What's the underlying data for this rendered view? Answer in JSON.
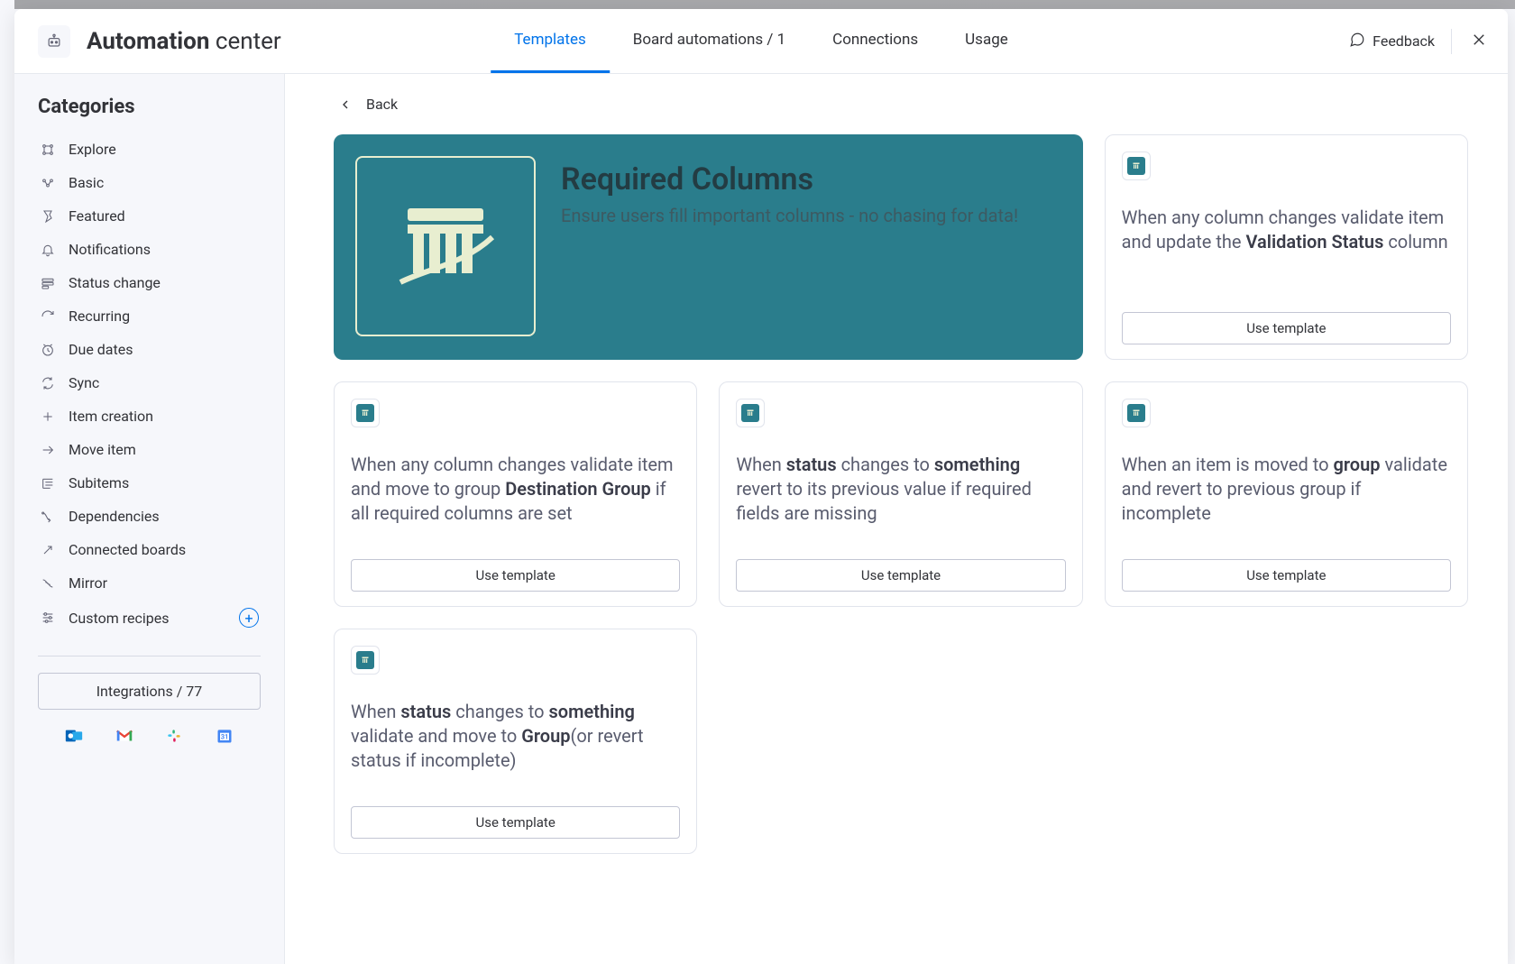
{
  "header": {
    "title_bold": "Automation",
    "title_light": " center",
    "tabs": [
      {
        "label": "Templates",
        "active": true
      },
      {
        "label": "Board automations / 1",
        "active": false
      },
      {
        "label": "Connections",
        "active": false
      },
      {
        "label": "Usage",
        "active": false
      }
    ],
    "feedback": "Feedback"
  },
  "sidebar": {
    "title": "Categories",
    "items": [
      {
        "label": "Explore",
        "icon": "explore"
      },
      {
        "label": "Basic",
        "icon": "basic"
      },
      {
        "label": "Featured",
        "icon": "featured"
      },
      {
        "label": "Notifications",
        "icon": "bell"
      },
      {
        "label": "Status change",
        "icon": "status"
      },
      {
        "label": "Recurring",
        "icon": "recurring"
      },
      {
        "label": "Due dates",
        "icon": "clock"
      },
      {
        "label": "Sync",
        "icon": "sync"
      },
      {
        "label": "Item creation",
        "icon": "plus"
      },
      {
        "label": "Move item",
        "icon": "arrow"
      },
      {
        "label": "Subitems",
        "icon": "subitems"
      },
      {
        "label": "Dependencies",
        "icon": "deps"
      },
      {
        "label": "Connected boards",
        "icon": "connected"
      },
      {
        "label": "Mirror",
        "icon": "mirror"
      },
      {
        "label": "Custom recipes",
        "icon": "custom",
        "add": true
      }
    ],
    "integrations_label": "Integrations / 77"
  },
  "main": {
    "back": "Back",
    "hero": {
      "title": "Required Columns",
      "subtitle": "Ensure users fill important columns - no chasing for data!"
    },
    "use_template": "Use template",
    "cards": [
      {
        "segments": [
          {
            "t": "When any column changes validate item and update the "
          },
          {
            "t": "Validation Status",
            "b": true
          },
          {
            "t": " column"
          }
        ]
      },
      {
        "segments": [
          {
            "t": "When any column changes validate item and move to group "
          },
          {
            "t": "Destination Group",
            "b": true
          },
          {
            "t": " if all required columns are set"
          }
        ]
      },
      {
        "segments": [
          {
            "t": "When "
          },
          {
            "t": "status",
            "b": true
          },
          {
            "t": " changes to "
          },
          {
            "t": "something",
            "b": true
          },
          {
            "t": " revert to its previous value if required fields are missing"
          }
        ]
      },
      {
        "segments": [
          {
            "t": "When an item is moved to "
          },
          {
            "t": "group",
            "b": true
          },
          {
            "t": " validate and revert to previous group if incomplete"
          }
        ]
      },
      {
        "segments": [
          {
            "t": "When "
          },
          {
            "t": "status",
            "b": true
          },
          {
            "t": " changes to "
          },
          {
            "t": "something",
            "b": true
          },
          {
            "t": " validate and move to "
          },
          {
            "t": "Group",
            "b": true
          },
          {
            "t": "(or revert status if incomplete)"
          }
        ]
      }
    ]
  }
}
